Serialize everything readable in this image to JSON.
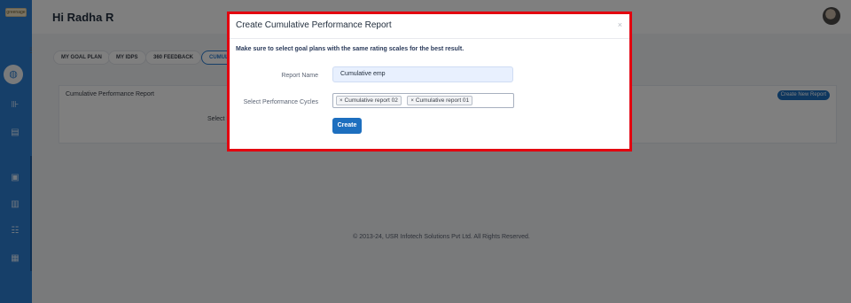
{
  "sidebar": {
    "logo_text": "greenage",
    "icons": [
      "menu-collapse-icon",
      "dashboard-icon",
      "analytics-icon",
      "document-icon",
      "report-icon",
      "book-icon",
      "team-icon",
      "calendar-icon"
    ]
  },
  "header": {
    "greeting": "Hi Radha R"
  },
  "tabs": [
    {
      "label": "MY GOAL PLAN"
    },
    {
      "label": "MY IDPS"
    },
    {
      "label": "360 FEEDBACK"
    },
    {
      "label": "CUMULATIVE"
    }
  ],
  "panel": {
    "title": "Cumulative Performance Report",
    "select_text": "Select F",
    "create_new_label": "Create New Report"
  },
  "footer": {
    "text": "© 2013-24, USR Infotech Solutions Pvt Ltd. All Rights Reserved."
  },
  "modal": {
    "title": "Create Cumulative Performance Report",
    "close_symbol": "×",
    "note": "Make sure to select goal plans with the same rating scales for the best result.",
    "report_name_label": "Report Name",
    "report_name_value": "Cumulative emp",
    "cycles_label": "Select Performance Cycles",
    "selected_cycles": [
      {
        "remove": "×",
        "label": "Cumulative report 02"
      },
      {
        "remove": "×",
        "label": "Cumulative report 01"
      }
    ],
    "create_label": "Create"
  },
  "colors": {
    "sidebar": "#2d7fd2",
    "primary_button": "#1d6fbf",
    "modal_highlight_border": "#e3000f"
  }
}
